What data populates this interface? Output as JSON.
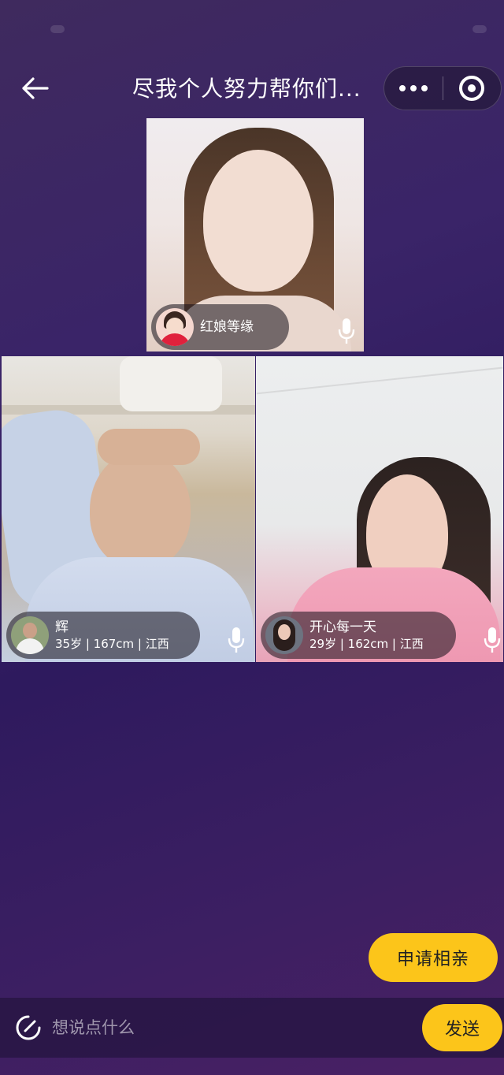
{
  "header": {
    "title": "尽我个人努力帮你们...",
    "back_icon": "arrow-left-icon",
    "more_icon": "more-dots-icon",
    "close_icon": "target-circle-icon"
  },
  "host": {
    "name": "红娘等缘",
    "mic_icon": "microphone-icon"
  },
  "guests": [
    {
      "name": "辉",
      "meta": "35岁 | 167cm | 江西",
      "mic_icon": "microphone-icon"
    },
    {
      "name": "开心每一天",
      "meta": "29岁 | 162cm | 江西",
      "mic_icon": "microphone-icon"
    }
  ],
  "actions": {
    "apply_label": "申请相亲"
  },
  "chat": {
    "placeholder": "想说点什么",
    "send_label": "发送",
    "icon": "chat-bubble-icon"
  },
  "colors": {
    "accent": "#fcc51a",
    "background": "#3a2468"
  }
}
